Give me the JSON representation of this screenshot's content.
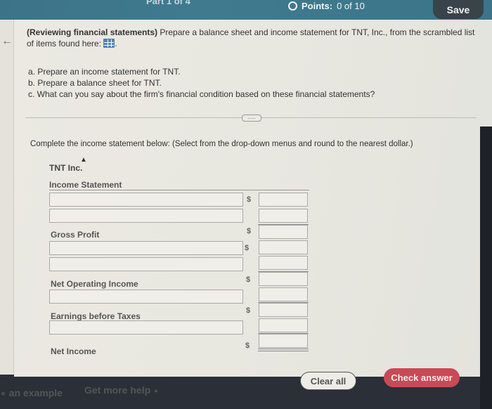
{
  "header": {
    "part_label": "Part 1 of 4",
    "points_label": "Points:",
    "points_value": "0 of 10",
    "save_label": "Save"
  },
  "question": {
    "title_bold": "(Reviewing financial statements)",
    "title_rest": " Prepare a balance sheet and income statement for TNT, Inc., from the scrambled list of items found here:",
    "title_end": ".",
    "data_icon": "grid-icon",
    "parts": [
      "a. Prepare an income statement for TNT.",
      "b. Prepare a balance sheet for TNT.",
      "c. What can you say about the firm's financial condition based on these financial statements?"
    ],
    "expand_label": "....."
  },
  "task": {
    "instruction": "Complete the income statement below: (Select from the drop-down menus and round to the nearest dollar.)",
    "company": "TNT Inc.",
    "statement_title": "Income Statement",
    "currency_symbol": "$",
    "labels": {
      "gross_profit": "Gross Profit",
      "net_operating_income": "Net Operating Income",
      "earnings_before_taxes": "Earnings before Taxes",
      "net_income": "Net Income"
    },
    "rows": [
      {
        "type": "select",
        "value": ""
      },
      {
        "type": "select",
        "value": ""
      },
      {
        "type": "total",
        "label_key": "gross_profit",
        "value": ""
      },
      {
        "type": "select",
        "value": ""
      },
      {
        "type": "select",
        "value": ""
      },
      {
        "type": "total",
        "label_key": "net_operating_income",
        "value": ""
      },
      {
        "type": "select",
        "value": ""
      },
      {
        "type": "total",
        "label_key": "earnings_before_taxes",
        "value": ""
      },
      {
        "type": "select",
        "value": ""
      },
      {
        "type": "total",
        "label_key": "net_income",
        "value": ""
      }
    ]
  },
  "footer": {
    "example_label": "an example",
    "more_help_label": "Get more help",
    "more_help_arrow": "▲",
    "clear_label": "Clear all",
    "check_label": "Check answer"
  },
  "colors": {
    "header_bg": "#3f7a8f",
    "check_button": "#c84a56",
    "save_button": "#38434a"
  }
}
